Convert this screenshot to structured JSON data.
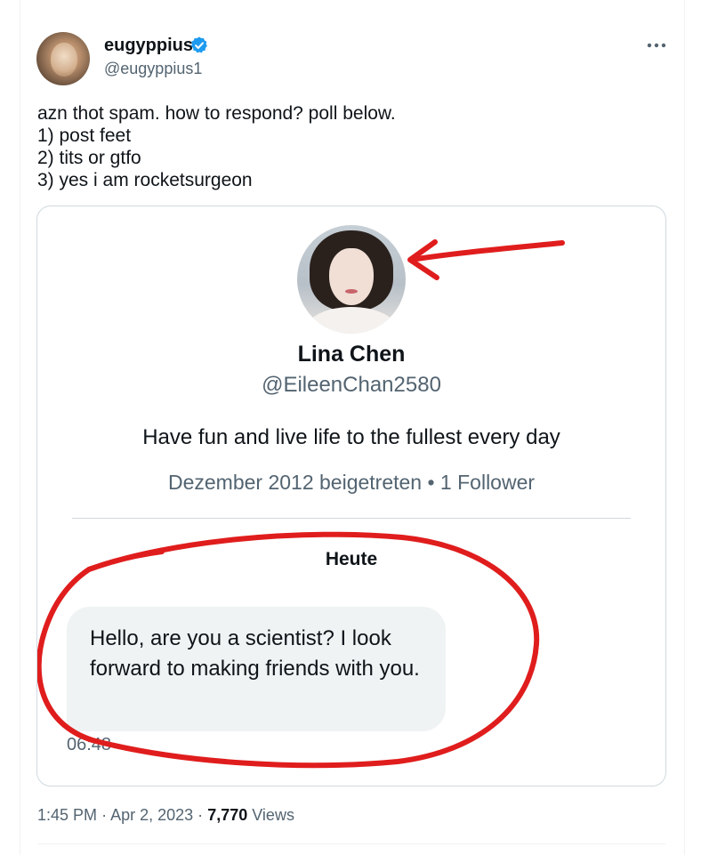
{
  "author": {
    "name": "eugyppius",
    "handle": "@eugyppius1",
    "verified": true
  },
  "tweet": {
    "lines": [
      "azn thot spam. how to respond? poll below.",
      "1) post feet",
      "2) tits or gtfo",
      "3) yes i am rocketsurgeon"
    ]
  },
  "screenshot": {
    "profile": {
      "name": "Lina Chen",
      "handle": "@EileenChan2580",
      "bio": "Have fun and live life to the fullest every day",
      "meta": "Dezember 2012 beigetreten • 1 Follower"
    },
    "day_separator": "Heute",
    "message": {
      "text": "Hello, are you a scientist? I look forward to making friends with you.",
      "time": "06:48"
    },
    "annotation_color": "#e01d1d"
  },
  "footer": {
    "time": "1:45 PM",
    "separator": "·",
    "date": "Apr 2, 2023",
    "views_count": "7,770",
    "views_label": "Views"
  },
  "colors": {
    "verified_blue": "#1d9bf0",
    "secondary_text": "#536471",
    "primary_text": "#0f1419",
    "border": "#cfd9de"
  },
  "icons": {
    "verified": "verified-badge-icon",
    "more": "more-horizontal-icon"
  }
}
